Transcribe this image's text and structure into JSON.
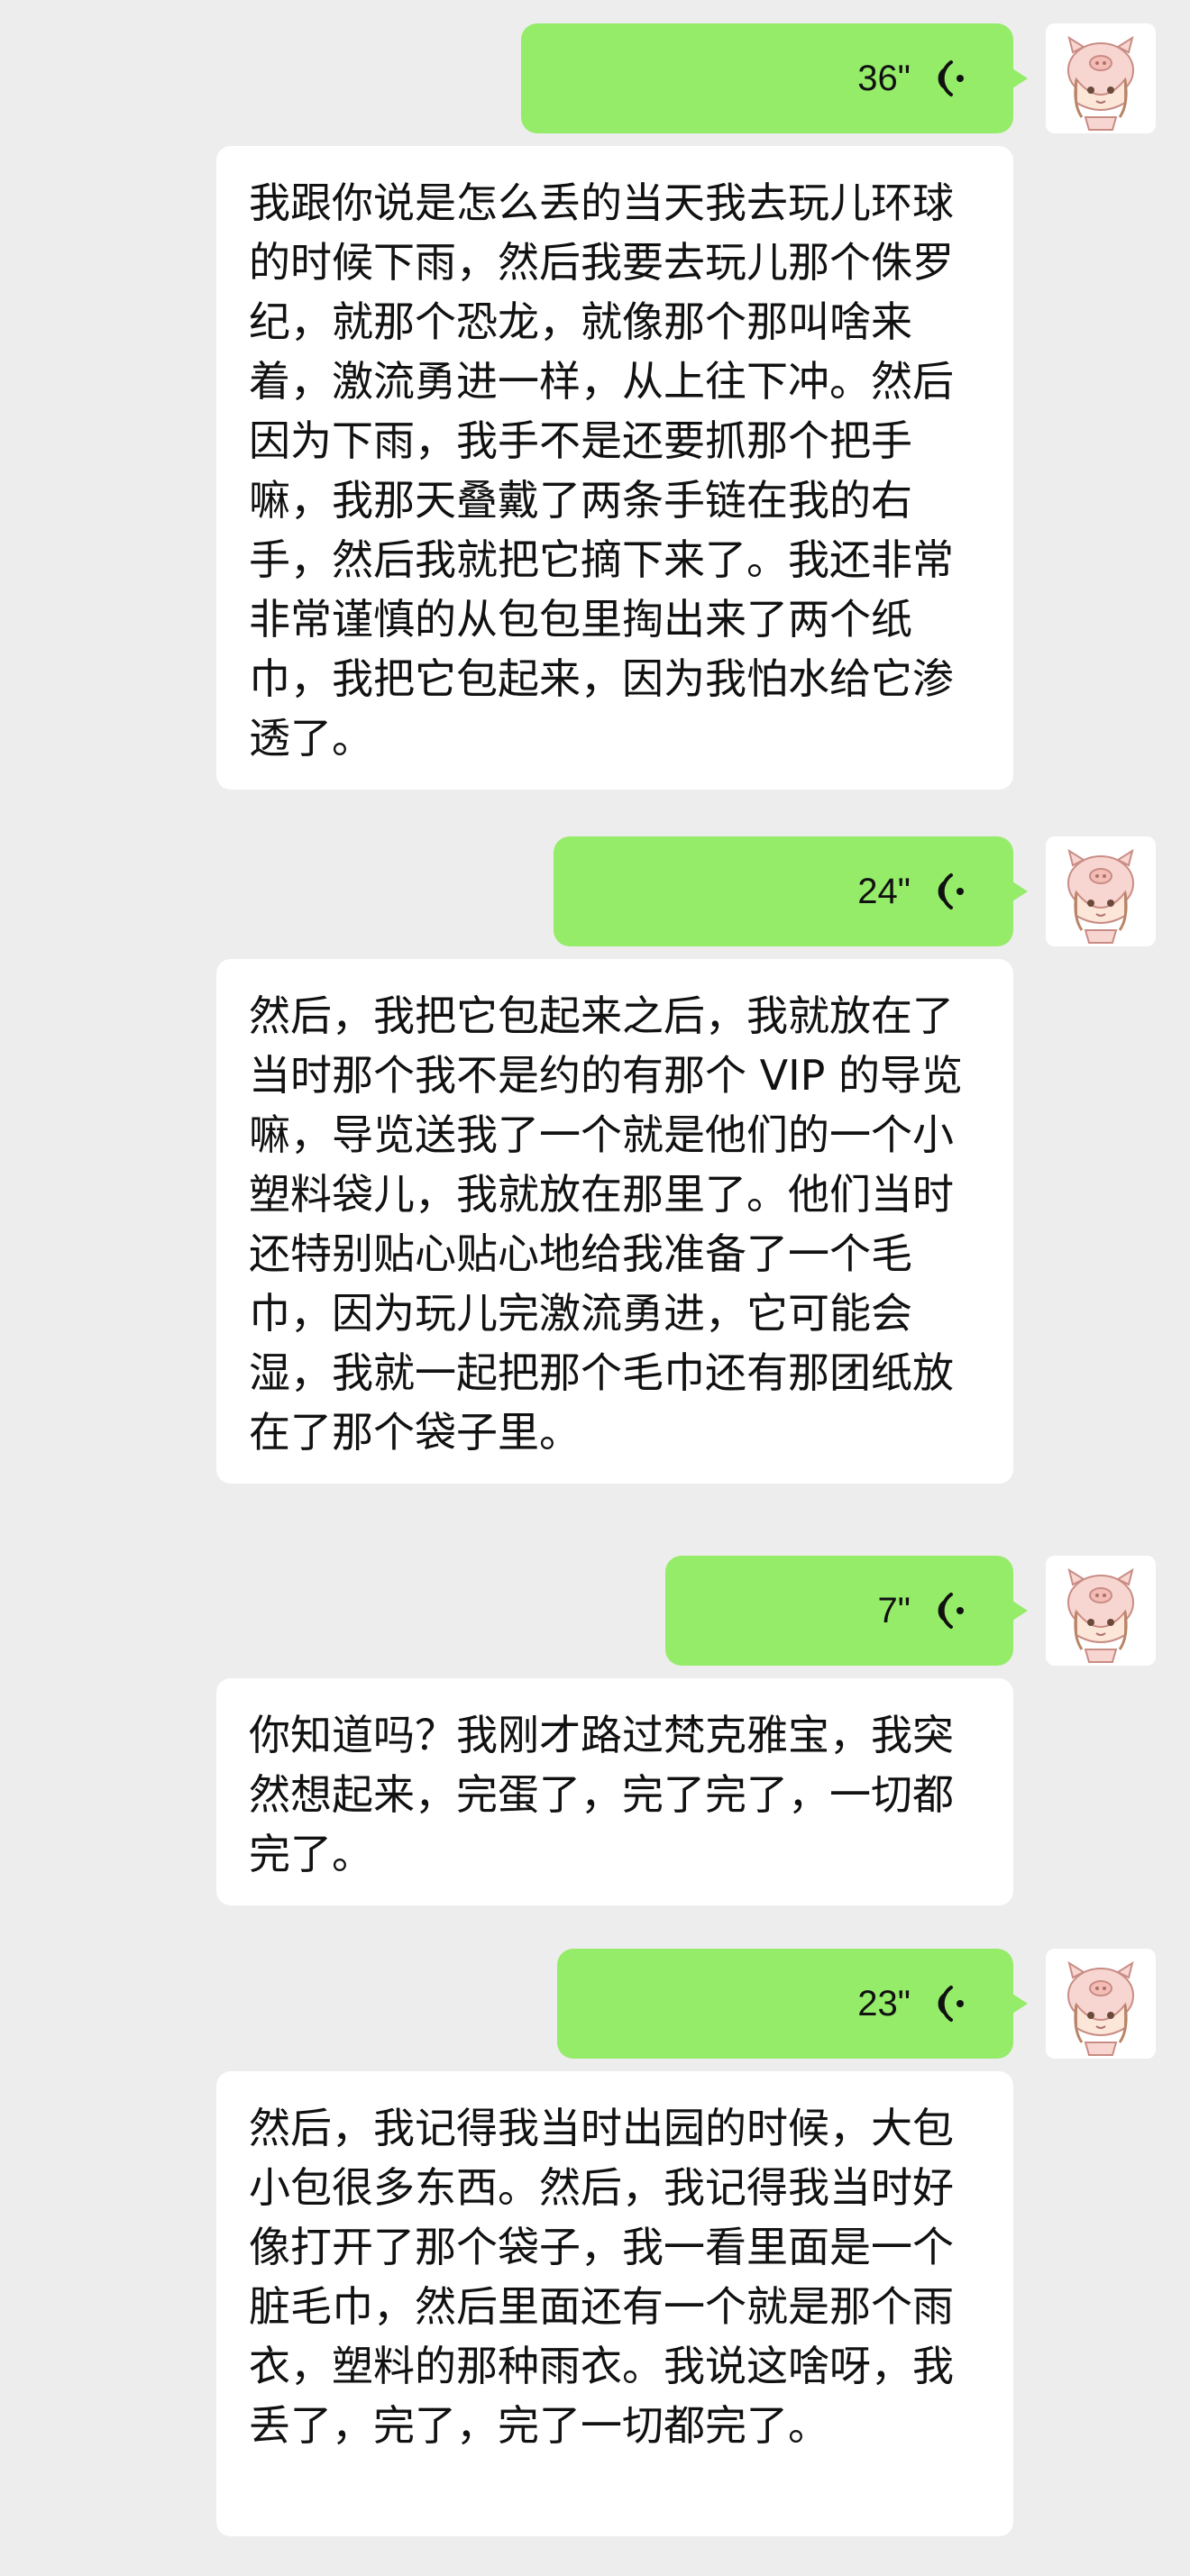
{
  "messages": [
    {
      "duration": "36\"",
      "transcript": "我跟你说是怎么丢的当天我去玩儿环球的时候下雨，然后我要去玩儿那个侏罗纪，就那个恐龙，就像那个那叫啥来着，激流勇进一样，从上往下冲。然后因为下雨，我手不是还要抓那个把手嘛，我那天叠戴了两条手链在我的右手，然后我就把它摘下来了。我还非常非常谨慎的从包包里掏出来了两个纸巾，我把它包起来，因为我怕水给它渗透了。"
    },
    {
      "duration": "24\"",
      "transcript": "然后，我把它包起来之后，我就放在了当时那个我不是约的有那个 VIP 的导览嘛，导览送我了一个就是他们的一个小塑料袋儿，我就放在那里了。他们当时还特别贴心贴心地给我准备了一个毛巾，因为玩儿完激流勇进，它可能会湿，我就一起把那个毛巾还有那团纸放在了那个袋子里。"
    },
    {
      "duration": "7\"",
      "transcript": "你知道吗？我刚才路过梵克雅宝，我突然想起来，完蛋了，完了完了，一切都完了。"
    },
    {
      "duration": "23\"",
      "transcript": "然后，我记得我当时出园的时候，大包小包很多东西。然后，我记得我当时好像打开了那个袋子，我一看里面是一个脏毛巾，然后里面还有一个就是那个雨衣，塑料的那种雨衣。我说这啥呀，我丢了，完了，完了一切都完了。"
    }
  ],
  "icons": {
    "voice": "voice-wave-icon",
    "avatar": "pig-hat-girl-avatar"
  },
  "colors": {
    "background": "#ededed",
    "sent_bubble": "#95ec69",
    "transcript_bubble": "#ffffff"
  }
}
